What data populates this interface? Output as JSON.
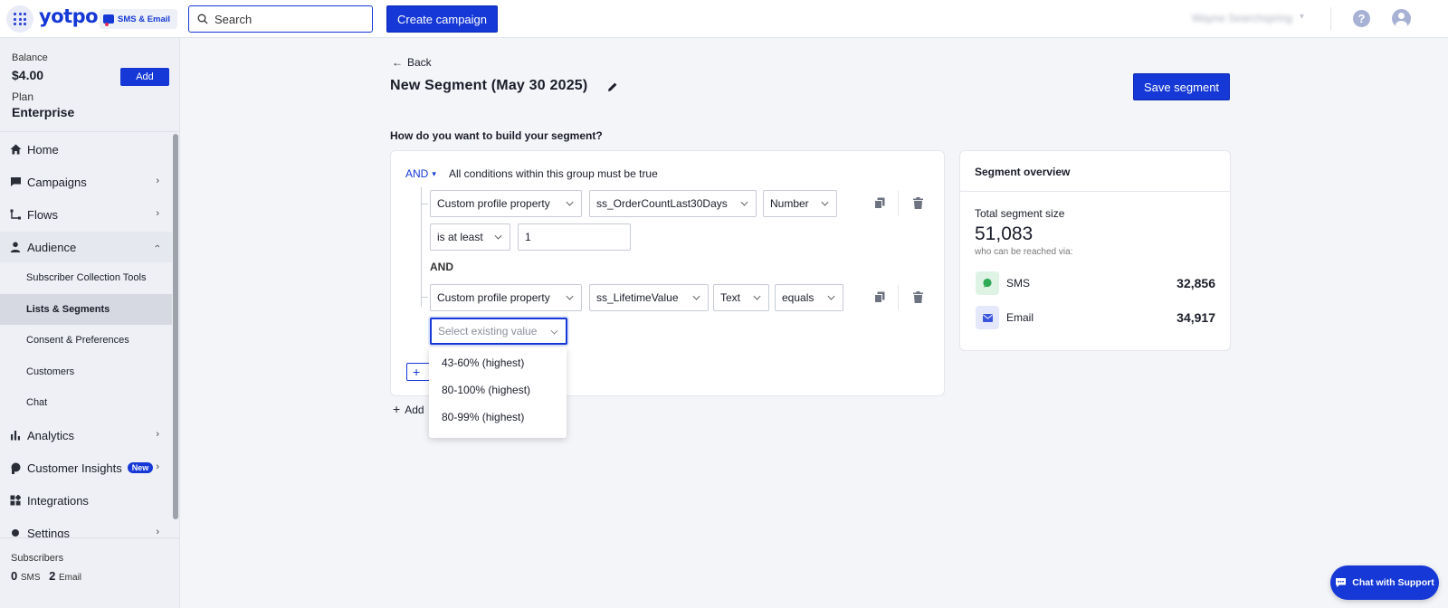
{
  "brand": {
    "logo": "yotpo.",
    "product": "SMS & Email",
    "accent": "#1538d6"
  },
  "topbar": {
    "search_placeholder": "Search",
    "create_label": "Create campaign",
    "user_name": "Wayne Searchspring"
  },
  "sidebar": {
    "balance_label": "Balance",
    "balance_value": "$4.00",
    "add_label": "Add",
    "plan_label": "Plan",
    "plan_value": "Enterprise",
    "nav": {
      "home": "Home",
      "campaigns": "Campaigns",
      "flows": "Flows",
      "audience": "Audience",
      "analytics": "Analytics",
      "customer_insights": "Customer Insights",
      "new_badge": "New",
      "integrations": "Integrations",
      "settings": "Settings"
    },
    "audience_sub": {
      "subscriber_tools": "Subscriber Collection Tools",
      "lists_segments": "Lists & Segments",
      "consent": "Consent & Preferences",
      "customers": "Customers",
      "chat": "Chat"
    },
    "footer": {
      "label": "Subscribers",
      "sms_count": "0",
      "sms_label": "SMS",
      "email_count": "2",
      "email_label": "Email"
    }
  },
  "main": {
    "back_label": "Back",
    "title": "New Segment (May 30 2025)",
    "save_label": "Save segment",
    "question": "How do you want to build your segment?",
    "group_operator": "AND",
    "group_text": "All conditions within this group must be true",
    "condition1": {
      "type": "Custom profile property",
      "property": "ss_OrderCountLast30Days",
      "data_type": "Number",
      "operator": "is at least",
      "value": "1"
    },
    "and_label": "AND",
    "condition2": {
      "type": "Custom profile property",
      "property": "ss_LifetimeValue",
      "data_type": "Text",
      "operator": "equals",
      "value_placeholder": "Select existing value"
    },
    "dropdown_options": [
      "43-60% (highest)",
      "80-100% (highest)",
      "80-99% (highest)"
    ],
    "add_condition_label": "+",
    "add_group_label": "Add"
  },
  "overview": {
    "title": "Segment overview",
    "size_label": "Total segment size",
    "size_value": "51,083",
    "reach_label": "who can be reached via:",
    "sms_label": "SMS",
    "sms_value": "32,856",
    "email_label": "Email",
    "email_value": "34,917"
  },
  "chat_label": "Chat with Support"
}
